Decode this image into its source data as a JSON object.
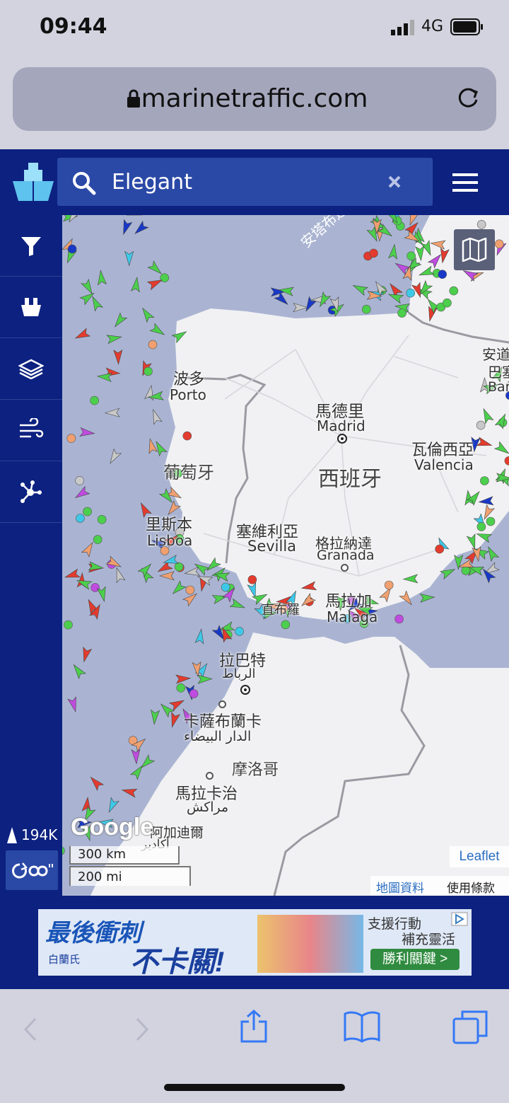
{
  "status_bar": {
    "time": "09:44",
    "network": "4G"
  },
  "browser": {
    "url": "marinetraffic.com"
  },
  "app_header": {
    "search_value": "Elegant"
  },
  "sidebar": {
    "vessel_count": "194K"
  },
  "map": {
    "labels": {
      "porto_cn": "波多",
      "porto": "Porto",
      "madrid_cn": "馬德里",
      "madrid": "Madrid",
      "portugal_cn": "葡萄牙",
      "spain_cn": "西班牙",
      "valencia_cn": "瓦倫西亞",
      "valencia": "Valencia",
      "andorra_cn": "安道",
      "barcelona_cn": "巴塞",
      "barcelona": "Bar",
      "lisbon_cn": "里斯本",
      "lisbon": "Lisboa",
      "sevilla_cn": "塞維利亞",
      "sevilla": "Sevilla",
      "granada_cn": "格拉納達",
      "granada": "Granada",
      "malaga_cn": "馬拉加",
      "malaga": "Malaga",
      "algeciras_cn": "直布羅",
      "rabat_cn": "拉巴特",
      "rabat_ar": "الرباط",
      "casablanca_cn": "卡薩布蘭卡",
      "casablanca_ar": "الدار البيضاء",
      "morocco_cn": "摩洛哥",
      "marrakech_cn": "馬拉卡治",
      "marrakech_ar": "مراكش",
      "agadir_cn": "阿加迪爾",
      "agadir_ar": "أكادير",
      "shipping_route": "安塔布連"
    },
    "google_logo": "Google",
    "scale_km": "300 km",
    "scale_mi": "200 mi",
    "leaflet": "Leaflet",
    "map_data": "地圖資料",
    "terms": "使用條款"
  },
  "ad": {
    "headline1": "最後衝刺",
    "headline2": "不卡關!",
    "brand": "白蘭氏",
    "tagline1": "支援行動",
    "tagline2": "補充靈活",
    "cta": "勝利關鍵 >"
  },
  "colors": {
    "navy": "#0c2180",
    "search_blue": "#2a49a6",
    "ios_blue": "#3478f6"
  }
}
